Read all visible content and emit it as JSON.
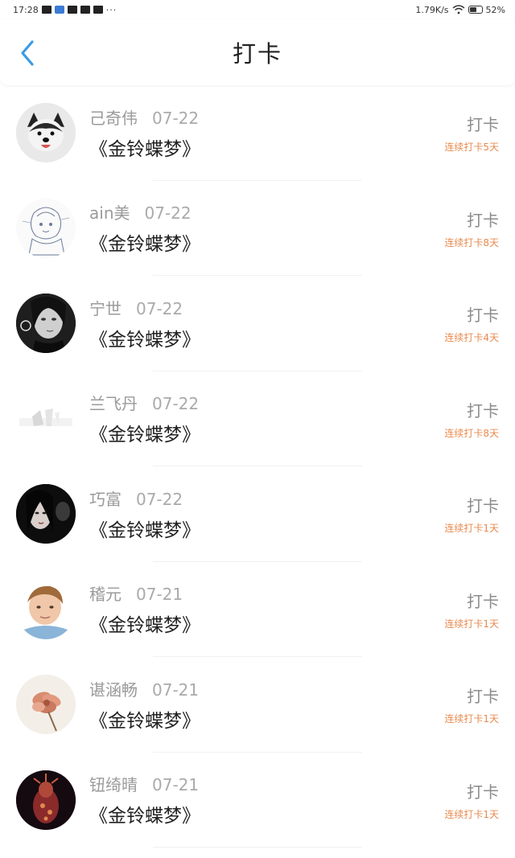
{
  "status_bar": {
    "time": "17:28",
    "network_speed": "1.79K/s",
    "battery": "52%"
  },
  "header": {
    "title": "打卡"
  },
  "entries": [
    {
      "name": "己奇伟",
      "date": "07-22",
      "book": "《金铃蝶梦》",
      "action": "打卡",
      "streak": "连续打卡5天"
    },
    {
      "name": "ain美",
      "date": "07-22",
      "book": "《金铃蝶梦》",
      "action": "打卡",
      "streak": "连续打卡8天"
    },
    {
      "name": "宁世",
      "date": "07-22",
      "book": "《金铃蝶梦》",
      "action": "打卡",
      "streak": "连续打卡4天"
    },
    {
      "name": "兰飞丹",
      "date": "07-22",
      "book": "《金铃蝶梦》",
      "action": "打卡",
      "streak": "连续打卡8天"
    },
    {
      "name": "巧富",
      "date": "07-22",
      "book": "《金铃蝶梦》",
      "action": "打卡",
      "streak": "连续打卡1天"
    },
    {
      "name": "稽元",
      "date": "07-21",
      "book": "《金铃蝶梦》",
      "action": "打卡",
      "streak": "连续打卡1天"
    },
    {
      "name": "谌涵畅",
      "date": "07-21",
      "book": "《金铃蝶梦》",
      "action": "打卡",
      "streak": "连续打卡1天"
    },
    {
      "name": "钮绮晴",
      "date": "07-21",
      "book": "《金铃蝶梦》",
      "action": "打卡",
      "streak": "连续打卡1天"
    }
  ],
  "colors": {
    "accent_blue": "#3a9be6",
    "streak_orange": "#e88a4e",
    "title_text": "#222222",
    "muted_text": "#9a9a9a"
  }
}
